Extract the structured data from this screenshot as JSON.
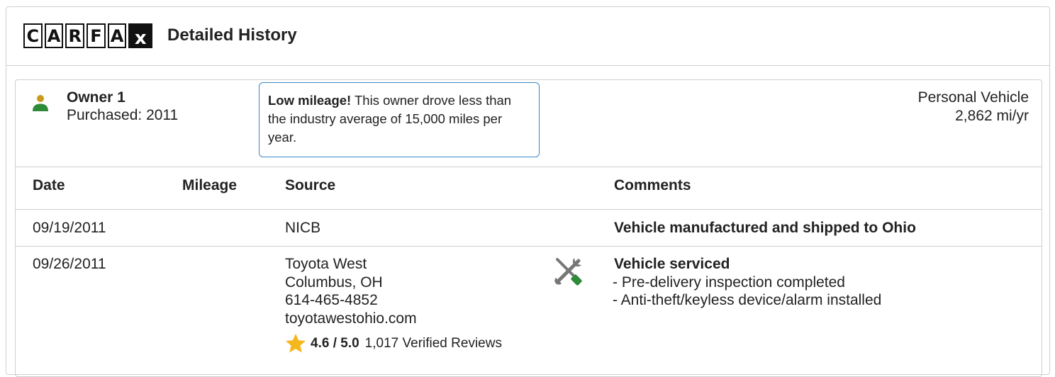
{
  "header": {
    "logo_letters": [
      "C",
      "A",
      "R",
      "F",
      "A",
      "x"
    ],
    "title": "Detailed History"
  },
  "owner": {
    "name": "Owner 1",
    "purchased": "Purchased: 2011",
    "callout_bold": "Low mileage!",
    "callout_text": " This owner drove less than the industry average of 15,000 miles per year.",
    "vehicle_type": "Personal Vehicle",
    "mileage_rate": "2,862 mi/yr",
    "icon_color": "#c89b1d",
    "icon_body_color": "#2e8b3a"
  },
  "table": {
    "columns": [
      "Date",
      "Mileage",
      "Source",
      "Comments"
    ],
    "rows": [
      {
        "date": "09/19/2011",
        "mileage": "",
        "source_lines": [
          "NICB"
        ],
        "comment_title": "Vehicle manufactured and shipped to Ohio",
        "comment_items": []
      },
      {
        "date": "09/26/2011",
        "mileage": "",
        "source_lines": [
          "Toyota West",
          "Columbus, OH",
          "614-465-4852",
          "toyotawestohio.com"
        ],
        "rating_score": "4.6 / 5.0",
        "rating_reviews": "1,017 Verified Reviews",
        "comment_icon": "service-tools-icon",
        "comment_title": "Vehicle serviced",
        "comment_items": [
          "- Pre-delivery inspection completed",
          "- Anti-theft/keyless device/alarm installed"
        ]
      }
    ]
  },
  "colors": {
    "callout_border": "#3a86c8",
    "star": "#f5b81c",
    "wrench_green": "#2e8b3a"
  }
}
